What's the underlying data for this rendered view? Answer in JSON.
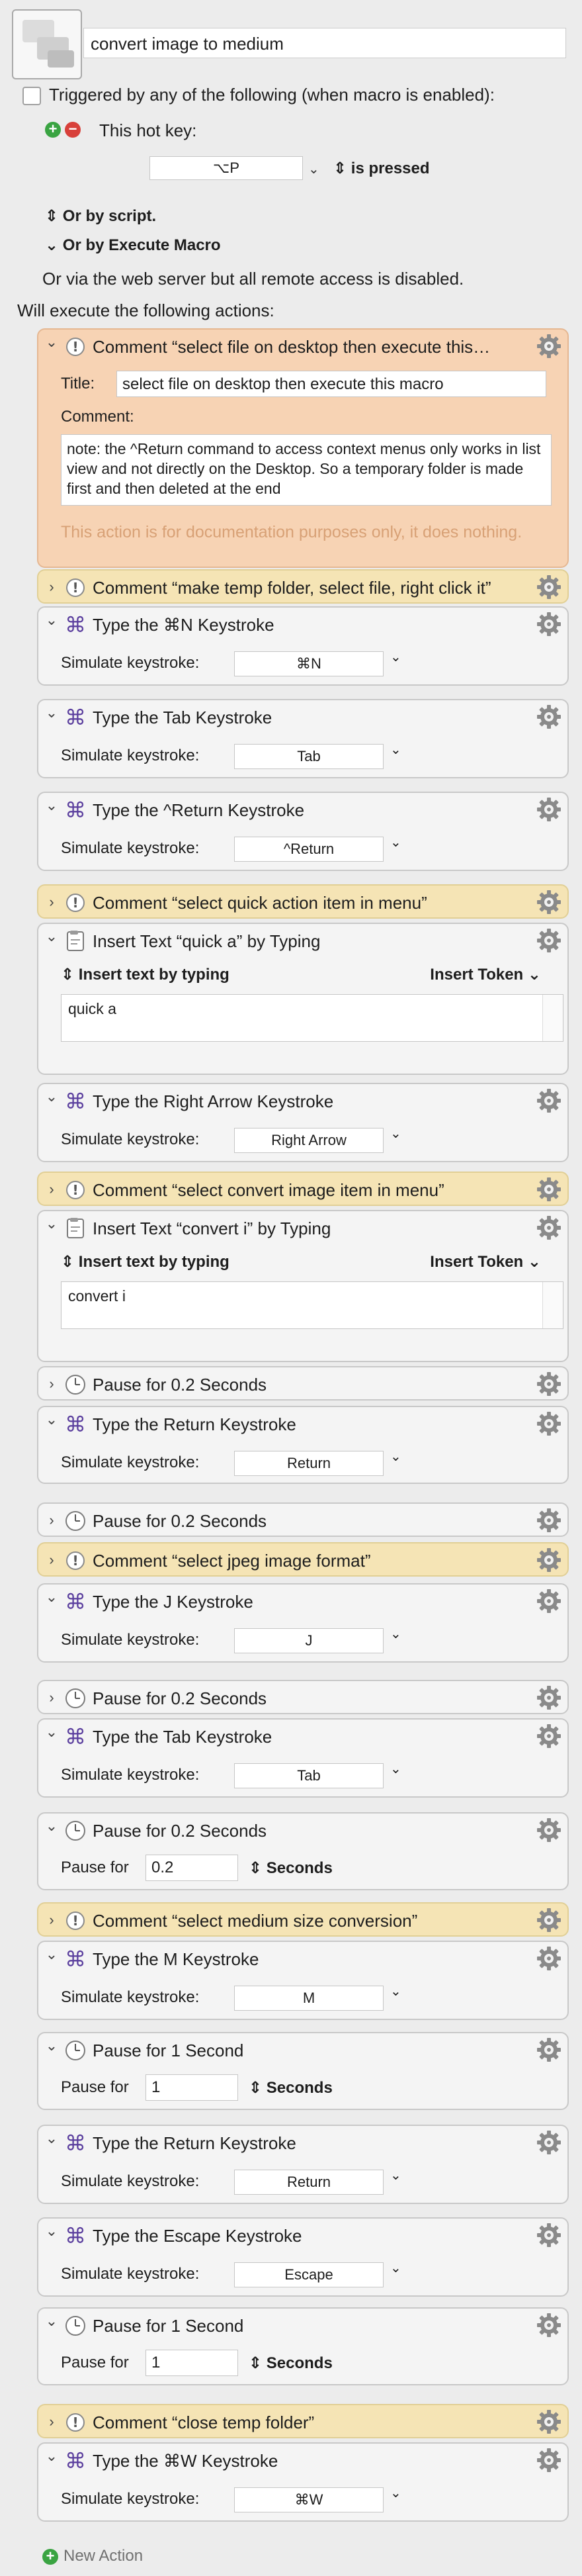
{
  "macro": {
    "name": "convert image to medium"
  },
  "trigger": {
    "triggered_by": "Triggered by any of the following (when macro is enabled):",
    "hot_key_label": "This hot key:",
    "hot_key_value": "⌥P",
    "is_pressed": "is pressed",
    "or_by_script": "Or by script.",
    "or_by_execute": "Or by Execute Macro",
    "web_server": "Or via the web server but all remote access is disabled."
  },
  "will_execute": "Will execute the following actions:",
  "actions": [
    {
      "kind": "comment_expanded",
      "title": "Comment “select file on desktop then execute this…",
      "title_label": "Title:",
      "title_value": "select file on desktop then execute this macro",
      "comment_label": "Comment:",
      "comment_value": "note: the ^Return command to access context menus only works in list view and not directly on the Desktop. So a temporary folder is made first and then deleted at the end",
      "footer": "This action is for documentation purposes only, it does nothing."
    },
    {
      "kind": "comment",
      "title": "Comment “make temp folder, select file, right click it”"
    },
    {
      "kind": "keystroke",
      "title": "Type the ⌘N Keystroke",
      "label": "Simulate keystroke:",
      "value": "⌘N"
    },
    {
      "kind": "keystroke",
      "title": "Type the Tab Keystroke",
      "label": "Simulate keystroke:",
      "value": "Tab"
    },
    {
      "kind": "keystroke",
      "title": "Type the ^Return Keystroke",
      "label": "Simulate keystroke:",
      "value": "^Return"
    },
    {
      "kind": "comment",
      "title": "Comment “select quick action item in menu”"
    },
    {
      "kind": "insert",
      "title": "Insert Text “quick a” by Typing",
      "mode": "Insert text by typing",
      "token": "Insert Token",
      "text": "quick a"
    },
    {
      "kind": "keystroke",
      "title": "Type the Right Arrow Keystroke",
      "label": "Simulate keystroke:",
      "value": "Right Arrow"
    },
    {
      "kind": "comment",
      "title": "Comment “select convert image item in menu”"
    },
    {
      "kind": "insert",
      "title": "Insert Text “convert i” by Typing",
      "mode": "Insert text by typing",
      "token": "Insert Token",
      "text": "convert i"
    },
    {
      "kind": "pause_collapsed",
      "title": "Pause for 0.2 Seconds"
    },
    {
      "kind": "keystroke",
      "title": "Type the Return Keystroke",
      "label": "Simulate keystroke:",
      "value": "Return"
    },
    {
      "kind": "pause_collapsed",
      "title": "Pause for 0.2 Seconds"
    },
    {
      "kind": "comment",
      "title": "Comment “select jpeg image format”"
    },
    {
      "kind": "keystroke",
      "title": "Type the J Keystroke",
      "label": "Simulate keystroke:",
      "value": "J"
    },
    {
      "kind": "pause_collapsed",
      "title": "Pause for 0.2 Seconds"
    },
    {
      "kind": "keystroke",
      "title": "Type the Tab Keystroke",
      "label": "Simulate keystroke:",
      "value": "Tab"
    },
    {
      "kind": "pause",
      "title": "Pause for 0.2 Seconds",
      "label": "Pause for",
      "value": "0.2",
      "unit": "Seconds"
    },
    {
      "kind": "comment",
      "title": "Comment “select medium size conversion”"
    },
    {
      "kind": "keystroke",
      "title": "Type the M Keystroke",
      "label": "Simulate keystroke:",
      "value": "M"
    },
    {
      "kind": "pause",
      "title": "Pause for 1 Second",
      "label": "Pause for",
      "value": "1",
      "unit": "Seconds"
    },
    {
      "kind": "keystroke",
      "title": "Type the Return Keystroke",
      "label": "Simulate keystroke:",
      "value": "Return"
    },
    {
      "kind": "keystroke",
      "title": "Type the Escape Keystroke",
      "label": "Simulate keystroke:",
      "value": "Escape"
    },
    {
      "kind": "pause",
      "title": "Pause for 1 Second",
      "label": "Pause for",
      "value": "1",
      "unit": "Seconds"
    },
    {
      "kind": "comment",
      "title": "Comment “close temp folder”"
    },
    {
      "kind": "keystroke",
      "title": "Type the ⌘W Keystroke",
      "label": "Simulate keystroke:",
      "value": "⌘W"
    }
  ],
  "new_action": "New Action",
  "colors": {
    "comment_bg": "#f5e4b5",
    "comment_expanded_bg": "#f7d3b4",
    "card_bg": "#f4f4f4",
    "keystroke_icon": "#5b3f9e",
    "add_green": "#3aa442",
    "remove_red": "#d8403a"
  }
}
